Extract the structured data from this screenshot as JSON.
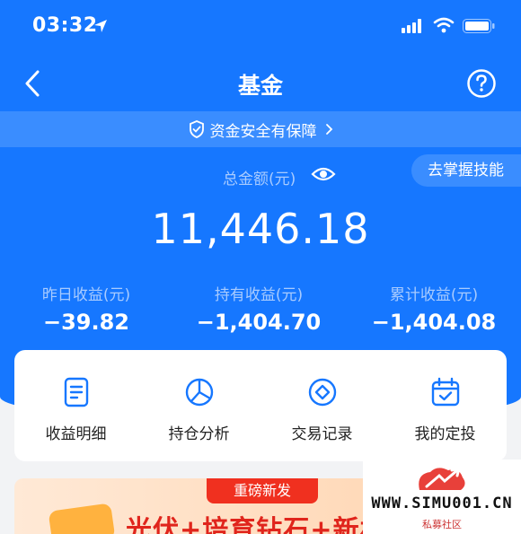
{
  "status_bar": {
    "time": "03:32"
  },
  "nav": {
    "title": "基金"
  },
  "security": {
    "text": "资金安全有保障"
  },
  "summary": {
    "total_label": "总金额(元)",
    "total_amount": "11,446.18",
    "skill_button": "去掌握技能"
  },
  "stats": [
    {
      "label": "昨日收益(元)",
      "value": "−39.82"
    },
    {
      "label": "持有收益(元)",
      "value": "−1,404.70"
    },
    {
      "label": "累计收益(元)",
      "value": "−1,404.08"
    }
  ],
  "actions": [
    {
      "label": "收益明细",
      "icon": "document-icon"
    },
    {
      "label": "持仓分析",
      "icon": "pie-chart-icon"
    },
    {
      "label": "交易记录",
      "icon": "trade-record-icon"
    },
    {
      "label": "我的定投",
      "icon": "calendar-check-icon"
    }
  ],
  "promo": {
    "tag": "重磅新发",
    "text": "光伏+培育钻石+新材"
  },
  "watermark": {
    "text": "WWW.SIMU001.CN",
    "subtext": "私募社区"
  },
  "colors": {
    "primary_blue": "#1677ff",
    "promo_red": "#f0301f"
  }
}
